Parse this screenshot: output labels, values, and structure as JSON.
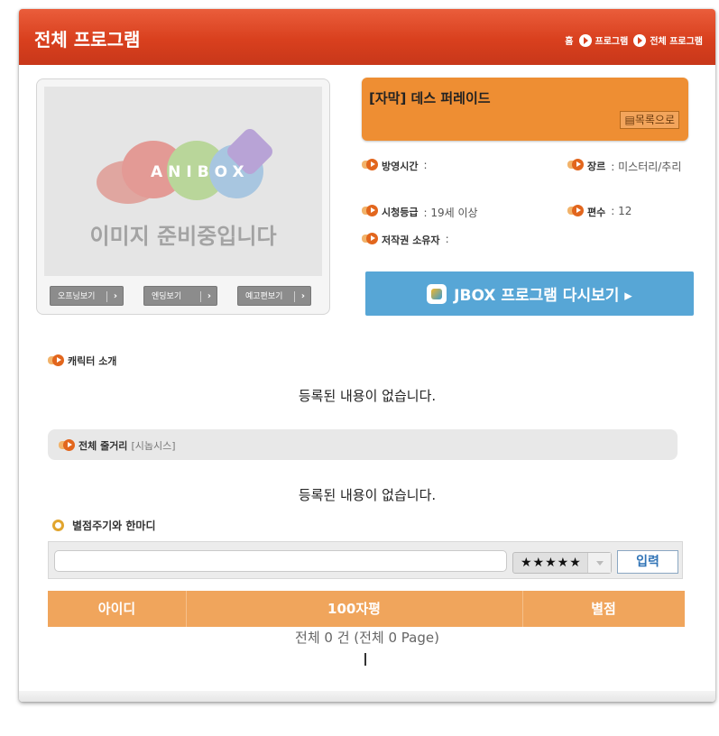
{
  "header": {
    "title": "전체 프로그램",
    "breadcrumb": [
      "홈",
      "프로그램",
      "전체 프로그램"
    ]
  },
  "image_box": {
    "logo_text": "ANIBOX",
    "placeholder": "이미지 준비중입니다",
    "buttons": [
      "오프닝보기",
      "엔딩보기",
      "예고편보기"
    ]
  },
  "program": {
    "title": "[자막] 데스 퍼레이드",
    "list_button": "목록으로",
    "info": {
      "airtime": {
        "label": "방영시간",
        "value": ":"
      },
      "genre": {
        "label": "장르",
        "value": ": 미스터리/추리"
      },
      "rating": {
        "label": "시청등급",
        "value": ": 19세 이상"
      },
      "episodes": {
        "label": "편수",
        "value": ": 12"
      },
      "copyright": {
        "label": "저작권 소유자",
        "value": ":"
      }
    },
    "jbox_button": "JBOX 프로그램 다시보기 ▸"
  },
  "characters": {
    "heading": "캐릭터 소개",
    "empty": "등록된 내용이 없습니다."
  },
  "synopsis": {
    "heading": "전체 줄거리",
    "subheading": "[시놉시스]",
    "empty": "등록된 내용이 없습니다."
  },
  "rating_section": {
    "heading": "별점주기와 한마디",
    "comment_value": "",
    "stars_selected": "★★★★★",
    "submit": "입력"
  },
  "review_table": {
    "columns": [
      "아이디",
      "100자평",
      "별점"
    ],
    "summary": "전체 0 건 (전체 0 Page)"
  },
  "colors": {
    "header": "#d9401e",
    "accent_orange": "#ee8e33",
    "table_header": "#f0a55c",
    "jbox_blue": "#57a6d6"
  }
}
